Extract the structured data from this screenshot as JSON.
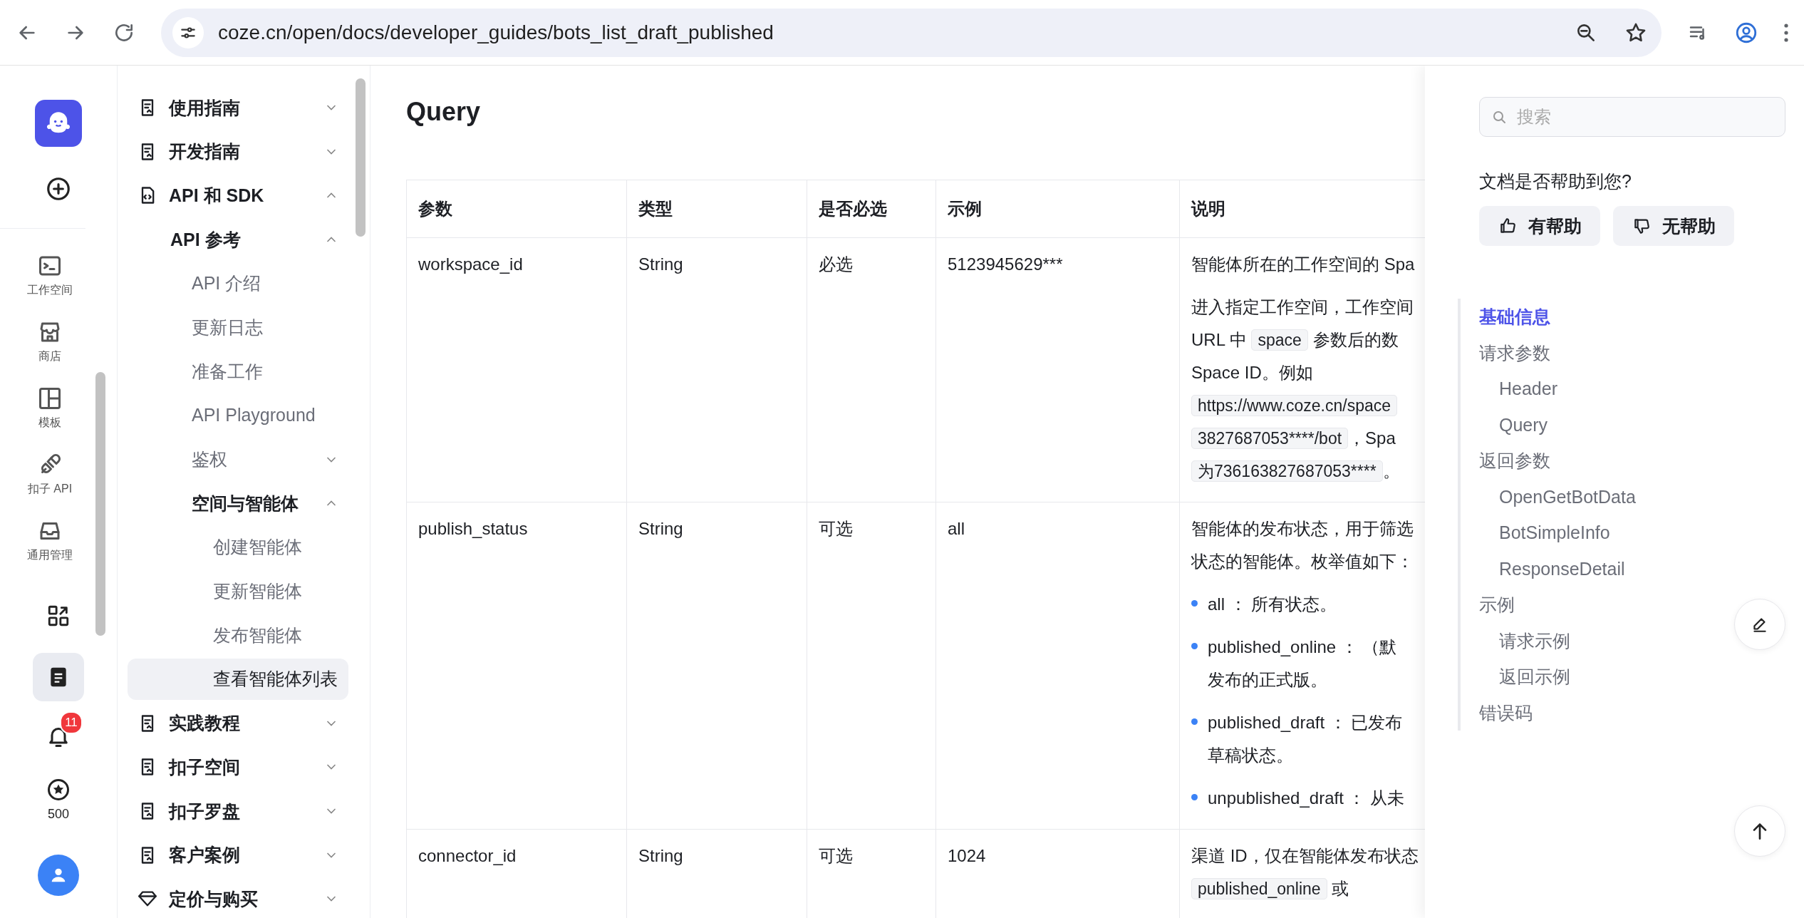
{
  "browser": {
    "url": "coze.cn/open/docs/developer_guides/bots_list_draft_published"
  },
  "rail": {
    "nav": [
      {
        "label": "工作空间"
      },
      {
        "label": "商店"
      },
      {
        "label": "模板"
      },
      {
        "label": "扣子 API"
      },
      {
        "label": "通用管理"
      }
    ],
    "tools": [
      {
        "selected": false
      },
      {
        "selected": true
      }
    ],
    "notifications": {
      "badge": "11"
    },
    "credits": {
      "label": "500"
    }
  },
  "sidebar": {
    "items": [
      {
        "label": "使用指南",
        "kind": "doc",
        "expanded": false,
        "selected": false
      },
      {
        "label": "开发指南",
        "kind": "doc",
        "expanded": false,
        "selected": false
      },
      {
        "label": "API 和 SDK",
        "kind": "code",
        "expanded": true,
        "selected": false,
        "children": [
          {
            "label": "API 参考",
            "expanded": true,
            "selected": false,
            "children": [
              {
                "label": "API 介绍",
                "selected": false
              },
              {
                "label": "更新日志",
                "selected": false
              },
              {
                "label": "准备工作",
                "selected": false
              },
              {
                "label": "API Playground",
                "selected": false
              },
              {
                "label": "鉴权",
                "expanded": false,
                "selected": false
              },
              {
                "label": "空间与智能体",
                "expanded": true,
                "selected": false,
                "children": [
                  {
                    "label": "创建智能体",
                    "selected": false
                  },
                  {
                    "label": "更新智能体",
                    "selected": false
                  },
                  {
                    "label": "发布智能体",
                    "selected": false
                  },
                  {
                    "label": "查看智能体列表",
                    "selected": true
                  }
                ]
              }
            ]
          }
        ]
      },
      {
        "label": "实践教程",
        "kind": "doc",
        "expanded": false,
        "selected": false
      },
      {
        "label": "扣子空间",
        "kind": "doc",
        "expanded": false,
        "selected": false
      },
      {
        "label": "扣子罗盘",
        "kind": "doc",
        "expanded": false,
        "selected": false
      },
      {
        "label": "客户案例",
        "kind": "doc",
        "expanded": false,
        "selected": false
      },
      {
        "label": "定价与购买",
        "kind": "price",
        "expanded": false,
        "selected": false
      }
    ]
  },
  "main": {
    "heading": "Query",
    "table": {
      "columns": [
        "参数",
        "类型",
        "是否必选",
        "示例",
        "说明"
      ],
      "rows": [
        {
          "cells": [
            "workspace_id",
            "String",
            "必选",
            "5123945629***"
          ],
          "description": [
            {
              "kind": "text",
              "lines": [
                [
                  {
                    "text": "智能体所在的工作空间的 Spa",
                    "code": false
                  }
                ]
              ]
            },
            {
              "kind": "text",
              "lines": [
                [
                  {
                    "text": "进入指定工作空间，工作空间",
                    "code": false
                  }
                ],
                [
                  {
                    "text": "URL 中 ",
                    "code": false
                  },
                  {
                    "text": "space",
                    "code": true
                  },
                  {
                    "text": " 参数后的数",
                    "code": false
                  }
                ],
                [
                  {
                    "text": "Space ID。例如",
                    "code": false
                  }
                ],
                [
                  {
                    "text": "https://www.coze.cn/space",
                    "code": true
                  }
                ],
                [
                  {
                    "text": "3827687053****/bot",
                    "code": true
                  },
                  {
                    "text": "，Spa",
                    "code": false
                  }
                ],
                [
                  {
                    "text": "为736163827687053****",
                    "code": true
                  },
                  {
                    "text": "。",
                    "code": false
                  }
                ]
              ]
            }
          ]
        },
        {
          "cells": [
            "publish_status",
            "String",
            "可选",
            "all"
          ],
          "description": [
            {
              "kind": "text",
              "lines": [
                [
                  {
                    "text": "智能体的发布状态，用于筛选",
                    "code": false
                  }
                ],
                [
                  {
                    "text": "状态的智能体。枚举值如下：",
                    "code": false
                  }
                ]
              ]
            },
            {
              "kind": "bullet",
              "lines": [
                [
                  {
                    "text": "all ： 所有状态。",
                    "code": false
                  }
                ]
              ]
            },
            {
              "kind": "bullet",
              "lines": [
                [
                  {
                    "text": "published_online ： （默",
                    "code": false
                  }
                ],
                [
                  {
                    "text": "发布的正式版。",
                    "code": false
                  }
                ]
              ]
            },
            {
              "kind": "bullet",
              "lines": [
                [
                  {
                    "text": "published_draft ： 已发布",
                    "code": false
                  }
                ],
                [
                  {
                    "text": "草稿状态。",
                    "code": false
                  }
                ]
              ]
            },
            {
              "kind": "bullet",
              "lines": [
                [
                  {
                    "text": "unpublished_draft ： 从未",
                    "code": false
                  }
                ]
              ]
            }
          ]
        },
        {
          "cells": [
            "connector_id",
            "String",
            "可选",
            "1024"
          ],
          "description": [
            {
              "kind": "text",
              "lines": [
                [
                  {
                    "text": "渠道 ID，仅在智能体发布状态",
                    "code": false
                  }
                ],
                [
                  {
                    "text": "published_online",
                    "code": true
                  },
                  {
                    "text": " 或",
                    "code": false
                  }
                ]
              ]
            }
          ]
        }
      ]
    }
  },
  "aside": {
    "search": {
      "placeholder": "搜索"
    },
    "feedback": {
      "question": "文档是否帮助到您?",
      "buttons": [
        "有帮助",
        "无帮助"
      ]
    },
    "toc": [
      {
        "label": "基础信息",
        "selected": true
      },
      {
        "label": "请求参数",
        "selected": false,
        "children": [
          {
            "label": "Header",
            "selected": false
          },
          {
            "label": "Query",
            "selected": false
          }
        ]
      },
      {
        "label": "返回参数",
        "selected": false,
        "children": [
          {
            "label": "OpenGetBotData",
            "selected": false
          },
          {
            "label": "BotSimpleInfo",
            "selected": false
          },
          {
            "label": "ResponseDetail",
            "selected": false
          }
        ]
      },
      {
        "label": "示例",
        "selected": false,
        "children": [
          {
            "label": "请求示例",
            "selected": false
          },
          {
            "label": "返回示例",
            "selected": false
          }
        ]
      },
      {
        "label": "错误码",
        "selected": false
      }
    ]
  }
}
